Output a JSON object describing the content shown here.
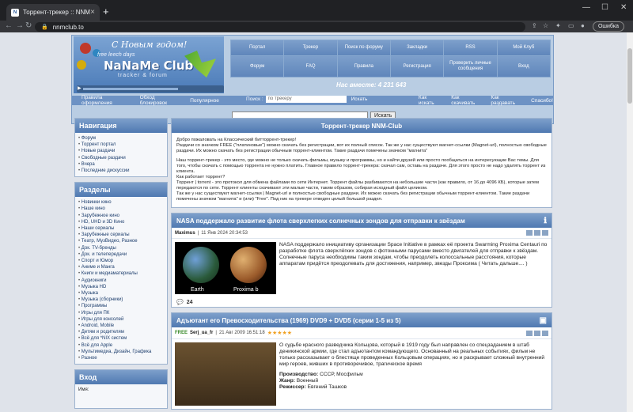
{
  "browser": {
    "tab_title": "Торрент-трекер :: NNM-Club",
    "url": "nnmclub.to",
    "error_button": "Ошибка"
  },
  "banner": {
    "greeting": "С Новым годом!",
    "free_leech": "free leech days",
    "logo": "NaNaMe Club",
    "subtitle": "tracker & forum"
  },
  "menu": [
    "Портал",
    "Трекер",
    "Поиск по форуму",
    "Закладки",
    "RSS",
    "Мой Клуб",
    "Форум",
    "FAQ",
    "Правила",
    "Регистрация",
    "Проверить личные сообщения",
    "Вход"
  ],
  "online_text": "Нас вместе: 4 231 643",
  "links": [
    "Правила оформления",
    "Обход блокировок",
    "Популярное"
  ],
  "search_top": {
    "label": "Поиск :",
    "placeholder": "по трекеру",
    "button": "Искать"
  },
  "links_right": [
    "Как искать",
    "Как скачивать",
    "Как раздавать",
    "Спасибо!"
  ],
  "search_main": {
    "button": "Искать"
  },
  "nav": {
    "title": "Навигация",
    "items": [
      "Форум",
      "Торрент портал",
      "Новые раздачи",
      "Свободные раздачи",
      "Вчера",
      "Последние дискуссии"
    ]
  },
  "sections": {
    "title": "Разделы",
    "items": [
      "Новинки кино",
      "Наше кино",
      "Зарубежное кино",
      "HD, UHD и 3D Кино",
      "Наши сериалы",
      "Зарубежные сериалы",
      "Театр, МузВидео, Разное",
      "Док. TV-бренды",
      "Док. и телепередачи",
      "Спорт и Юмор",
      "Аниме и Манга",
      "Книги и медиаматериалы",
      "Аудиокниги",
      "Музыка HD",
      "Музыка",
      "Музыка (сборники)",
      "Программы",
      "Игры для ПК",
      "Игры для консолей",
      "Android, Mobile",
      "Детям и родителям",
      "Всё для *NIX систем",
      "Всё для Apple",
      "Мультимедиа, Дизайн, Графика",
      "Разное"
    ]
  },
  "login": {
    "title": "Вход",
    "label": "Имя:"
  },
  "intro": {
    "title": "Торрент-трекер NNM-Club",
    "lines": [
      "Добро пожаловать на Классический битторрент-трекер!",
      "Раздачи со значком FREE (\"платиновые\") можно скачать без регистрации, вот их полный список. Так же у нас существуют магнет-ссылки (Magnet-url), полностью свободные раздачи. Их можно скачать без регистрации обычным торрент-клиентом. Такие раздачи помечены значком \"магнита\"",
      "Наш торрент-трекер - это место, где можно не только скачать фильмы, музыку и программы, но и найти друзей или просто пообщаться на интересующие Вас темы. Для того, чтобы скачать с помощью торрента не нужно платить. Главное правило торрент-трекера: скачал сам, оставь на раздаче. Для этого просто не надо удалять торрент из клиента.",
      "Как работает торрент?",
      "Торрент | torrent - это протокол для обмена файлами по сети Интернет. Торрент файлы разбиваются на небольшие части (как правило, от 16 до 4096 КБ), которые затем передаются по сети. Торрент клиенты скачивают эти малые части, таким образом, собирая исходный файл целиком.",
      "Так же у нас существуют магнет-ссылки | Magnet-url и полностью свободные раздачи. Их можно скачать без регистрации обычным торрент-клиентом. Такие раздачи помечены значком \"магнита\" и (или) \"Free\". Под ник на трекере отведен целый большой раздел."
    ]
  },
  "post1": {
    "title": "NASA поддержало развитие флота сверхлегких солнечных зондов для отправки к звёздам",
    "author": "Maximus",
    "date": "11 Янв 2024 20:34:53",
    "img_left": "Earth",
    "img_right": "Proxima b",
    "text": "NASA поддержало инициативу организации Space Initiative в рамках её проекта Swarming Proxima Centauri по разработке флота сверхлёгких зондов с фотонными парусами вместо двигателей для отправки к звёздам.",
    "text2": "Солнечные паруса необходимы таким зондам, чтобы преодолеть колоссальные расстояния, которые аппаратам придётся преодолевать для достижения, например, звезды Проксима ( Читать дальше.... )",
    "comments": "24"
  },
  "post2": {
    "title": "Адъютант его Превосходительства (1969) DVD9 + DVD5 (серии 1-5 из 5)",
    "badge": "FREE",
    "author": "Serj_ua_fr",
    "date": "21 Авг 2009 16:51:18",
    "stars": "★★★★★",
    "text": "О судьбе красного разведчика Кольцова, который в 1919 году был направлен со спецзаданием в штаб деникинской армии, где стал адъютантом командующего. Основанный на реальных событиях, фильм не только рассказывает о блестяще проведенных Кольцовым операциях, но и раскрывает сложный внутренний мир героев, живших в противоречивое, трагическое время",
    "prod_label": "Производство:",
    "prod": "СССР, Мосфильм",
    "genre_label": "Жанр:",
    "genre": "Военный",
    "dir_label": "Режиссер:",
    "dir": "Евгений Ташков"
  },
  "watermark": "NNM-Club"
}
